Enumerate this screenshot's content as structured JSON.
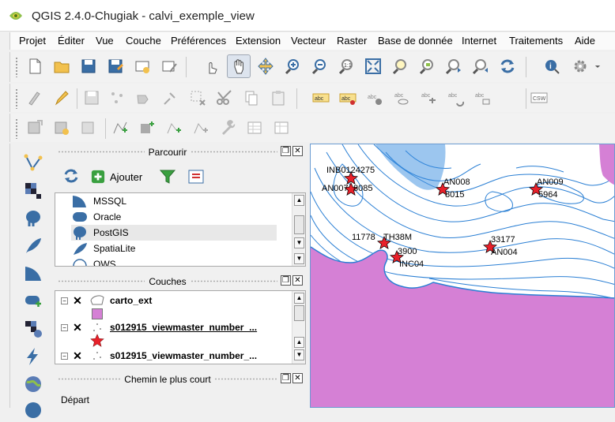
{
  "window": {
    "title": "QGIS 2.4.0-Chugiak - calvi_exemple_view"
  },
  "menubar": {
    "items": [
      "Projet",
      "Éditer",
      "Vue",
      "Couche",
      "Préférences",
      "Extension",
      "Vecteur",
      "Raster",
      "Base de donnée",
      "Internet",
      "Traitements",
      "Aide"
    ]
  },
  "toolbar3": {
    "csw_label": "CSW"
  },
  "browser_panel": {
    "title": "Parcourir",
    "add_label": "Ajouter",
    "items": [
      "MSSQL",
      "Oracle",
      "PostGIS",
      "SpatiaLite",
      "OWS"
    ],
    "selected": "PostGIS"
  },
  "layers_panel": {
    "title": "Couches",
    "layers": [
      "carto_ext",
      "s012915_viewmaster_number_...",
      "s012915_viewmaster_number_..."
    ]
  },
  "route_panel": {
    "title": "Chemin le plus court",
    "start_label": "Départ"
  },
  "map": {
    "labels": [
      "INB0124275",
      "AN007",
      "8085",
      "AN008",
      "8015",
      "AN009",
      "5964",
      "11778",
      "TH38M",
      "3900",
      "INC04",
      "33177",
      "AN004"
    ],
    "land_color": "#d580d5",
    "contour_color": "#2a7fd4",
    "marker_color": "#e8202a"
  },
  "colors": {
    "accent": "#6b9bd2",
    "pressed": "#dde4ee"
  }
}
